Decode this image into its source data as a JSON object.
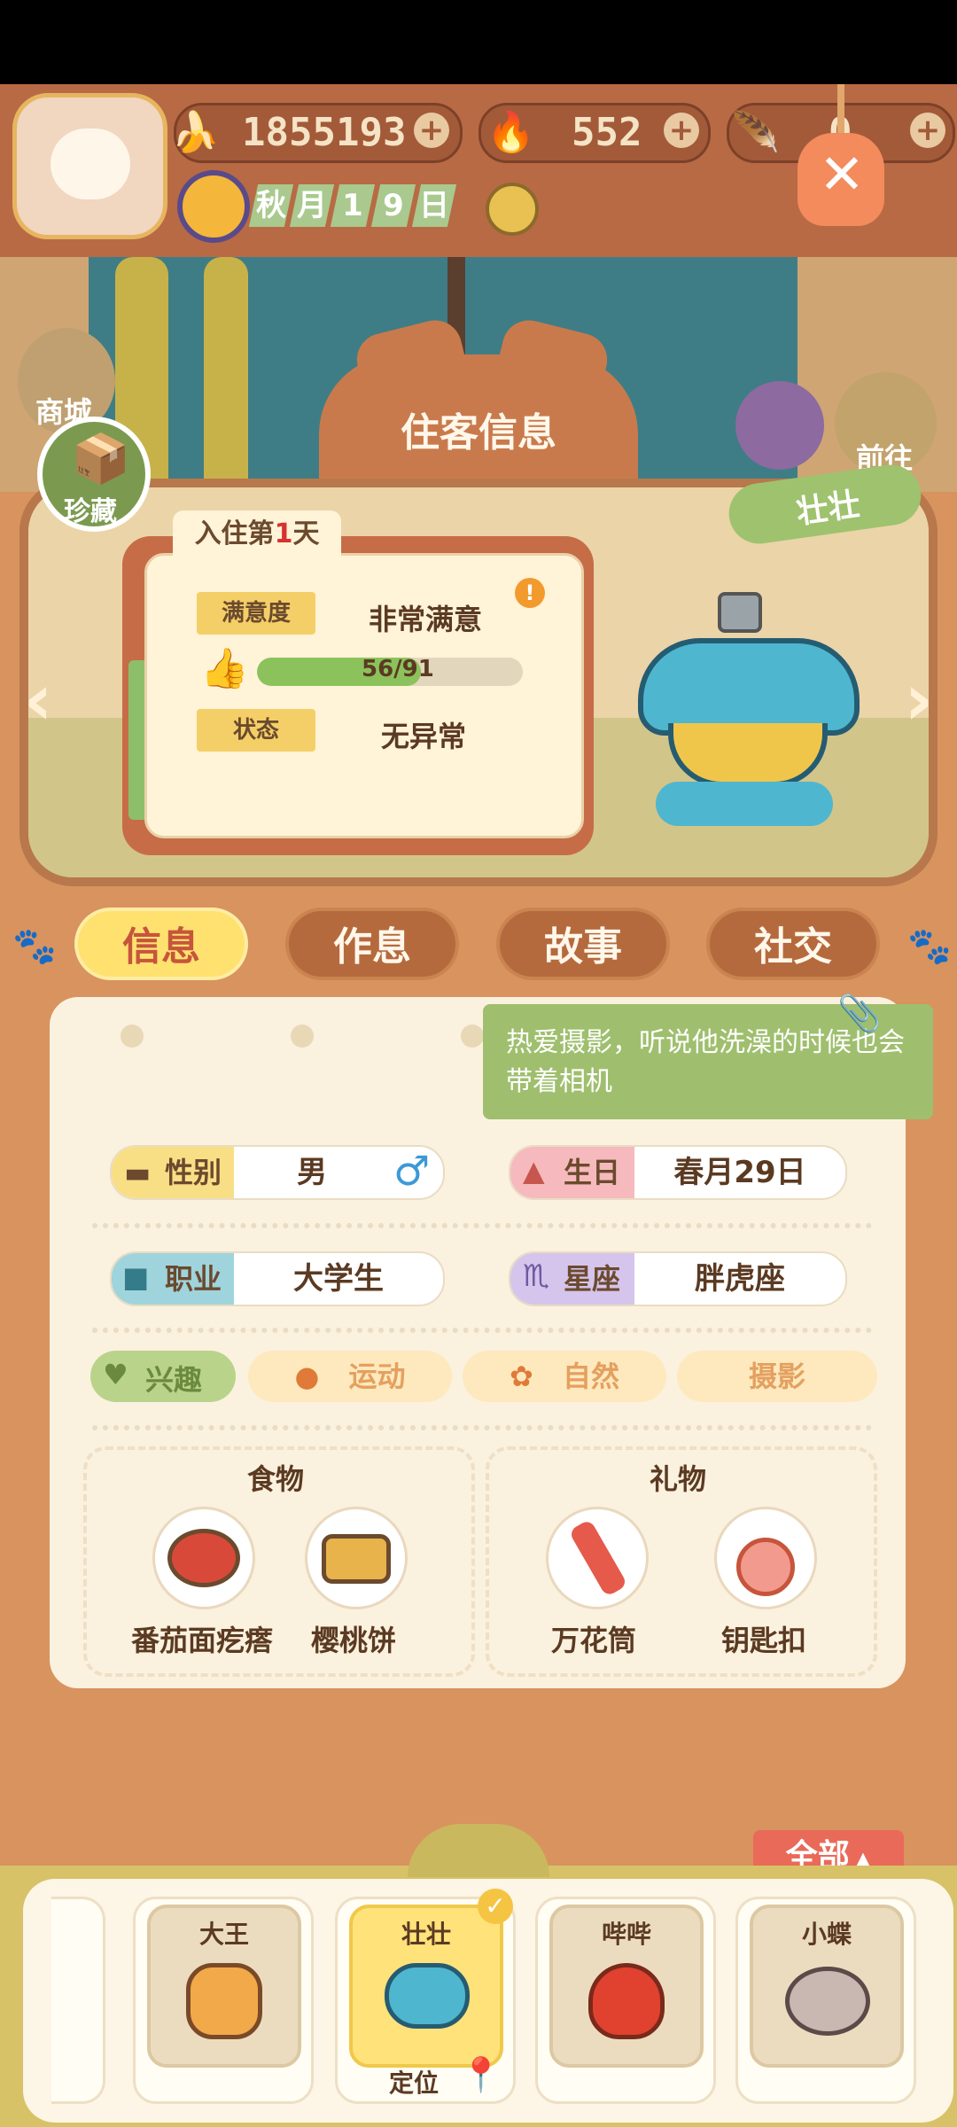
{
  "resources": {
    "bananas": "1855193",
    "flames": "552",
    "feathers": "0"
  },
  "date": {
    "season": "秋",
    "month": "月",
    "d1": "1",
    "d2": "9",
    "day": "日"
  },
  "side_buttons": {
    "shop": "商城",
    "collection": "珍藏",
    "goto": "前往"
  },
  "panel": {
    "title": "住客信息",
    "resident_name": "壮壮",
    "stay_prefix": "入住第",
    "stay_days": "1",
    "stay_suffix": "天",
    "satisfaction_label": "满意度",
    "satisfaction_value": "非常满意",
    "progress_text": "56/91",
    "progress_fraction": 0.615,
    "status_label": "状态",
    "status_value": "无异常"
  },
  "tabs": [
    "信息",
    "作息",
    "故事",
    "社交"
  ],
  "info": {
    "note": "热爱摄影，听说他洗澡的时候也会带着相机",
    "gender_label": "性别",
    "gender_value": "男",
    "birthday_label": "生日",
    "birthday_value": "春月29日",
    "job_label": "职业",
    "job_value": "大学生",
    "zodiac_label": "星座",
    "zodiac_value": "胖虎座",
    "interests_label": "兴趣",
    "interests": [
      "运动",
      "自然",
      "摄影"
    ],
    "food_title": "食物",
    "foods": [
      "番茄面疙瘩",
      "樱桃饼"
    ],
    "gift_title": "礼物",
    "gifts": [
      "万花筒",
      "钥匙扣"
    ]
  },
  "roster": {
    "all_button": "全部",
    "residents": [
      "大王",
      "壮壮",
      "哔哔",
      "小蝶"
    ],
    "locate_label": "定位"
  },
  "colors": {
    "accent": "#ffe170",
    "panel": "#d8935f",
    "note": "#9fbf6e"
  }
}
